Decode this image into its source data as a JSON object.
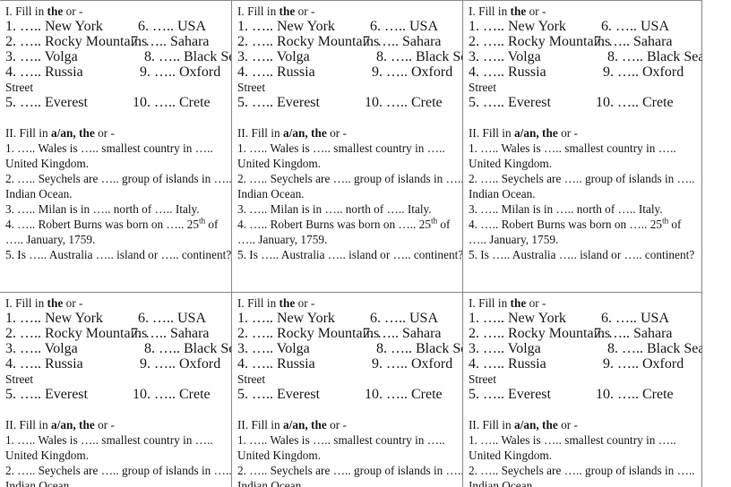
{
  "document": {
    "kind": "grammar-worksheet",
    "layout": {
      "columns": 3,
      "rows": 2,
      "identical_cells": true
    },
    "colors": {
      "text": "#1b1b1b",
      "border": "#8a8a8a",
      "background": "#ffffff"
    }
  },
  "worksheet": {
    "exercise_1": {
      "title_prefix": "I. Fill in ",
      "title_bold": "the",
      "title_suffix": " or -",
      "items_left": [
        "1. ….. New York",
        "2. ….. Rocky Mountains",
        "3. ….. Volga",
        "4. ….. Russia",
        "5. ….. Everest"
      ],
      "items_right": [
        "6. ….. USA",
        "7. ….. Sahara",
        "8. ….. Black Sea",
        "9. ….. Oxford",
        "10. ….. Crete"
      ],
      "wrap_line": "Street"
    },
    "exercise_2": {
      "title_prefix": "II. Fill in ",
      "title_bold": "a/an, the",
      "title_suffix": " or -",
      "q1": "1. ….. Wales is ….. smallest country in …..",
      "q1_wrap": "United Kingdom.",
      "q2": "2. ….. Seychels are ….. group of islands in …..",
      "q2_wrap": "Indian Ocean.",
      "q3": "3. ….. Milan is in ….. north of ….. Italy.",
      "q4_a": "4. ….. Robert Burns was born on ….. 25",
      "q4_sup": "th",
      "q4_b": " of",
      "q4_wrap": "….. January, 1759.",
      "q5": "5. Is ….. Australia ….. island or ….. continent?"
    }
  }
}
